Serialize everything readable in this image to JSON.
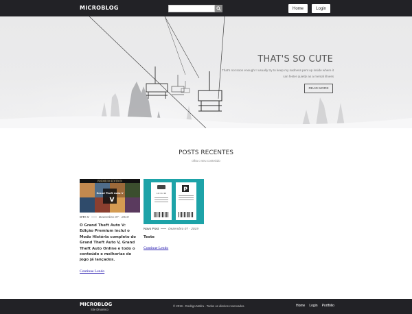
{
  "header": {
    "logo": "MICROBLOG",
    "search": {
      "placeholder": "",
      "button_icon": "search-icon"
    },
    "nav": [
      {
        "label": "Home"
      },
      {
        "label": "Login"
      }
    ]
  },
  "hero": {
    "title": "THAT'S SO CUTE",
    "text": "That's not soon enough! I usually try to keep my sadness pent up inside where it can fester quietly as a mental illness",
    "button": "READ MORE"
  },
  "posts_section": {
    "title": "POSTS RECENTES",
    "subtitle": "olha o seu conteúdo"
  },
  "posts": [
    {
      "category": "GTA V",
      "date": "Dezembro 07 · 2019",
      "title": "O Grand Theft Auto V: Edição Premium inclui o Modo História completo do Grand Theft Auto V, Grand Theft Auto Online e todo o conteúdo e melhorias de jogo já lançados.",
      "read_more": "Continue Lendo",
      "thumb": {
        "banner": "PREMIUM EDITION",
        "logo": "Grand Theft Auto V"
      }
    },
    {
      "category": "Novo Post",
      "date": "Dezembro 07 · 2019",
      "title": "Teste",
      "read_more": "Continue Lendo",
      "thumb": {
        "ticket_time": "16:31:03",
        "ticket_icon": "P"
      }
    }
  ],
  "footer": {
    "logo": "MICROBLOG",
    "sub": "Site Dinamico",
    "copyright": "© 2019 - Rodrigo Mafra - Todos os direitos reservados.",
    "links": [
      {
        "label": "Home"
      },
      {
        "label": "Login"
      },
      {
        "label": "Portfólio"
      }
    ]
  },
  "colors": {
    "header_bg": "#222226",
    "footer_bg": "#222226",
    "link": "#1a0dab",
    "ticket_bg": "#1da3a8"
  }
}
